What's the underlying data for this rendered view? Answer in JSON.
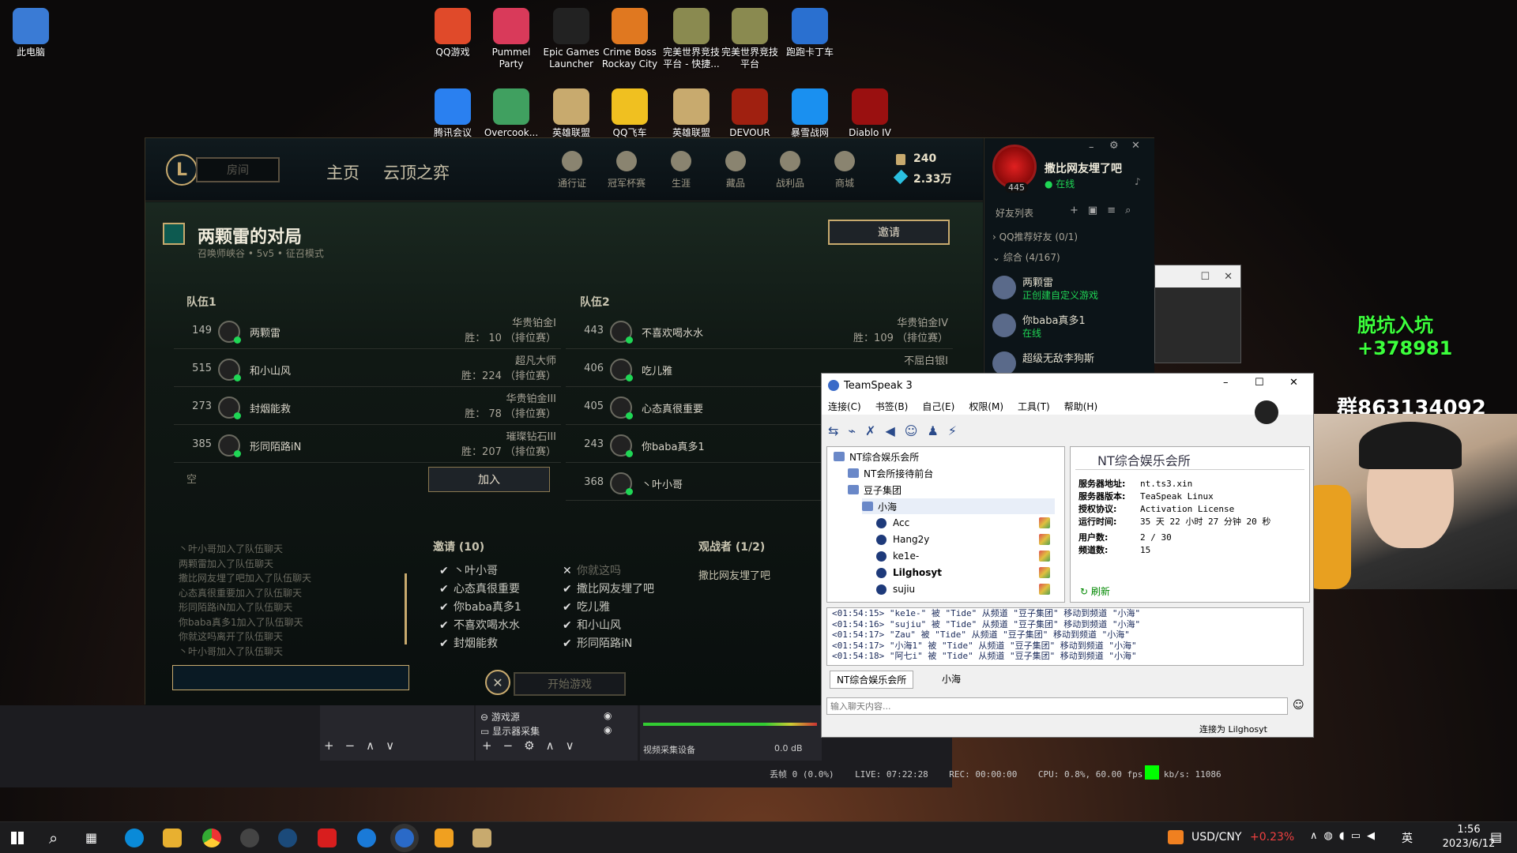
{
  "desktop": {
    "icons": [
      {
        "label": "此电脑",
        "color": "#3a7bd5"
      },
      {
        "label": "QQ游戏",
        "color": "#e04a2a"
      },
      {
        "label": "Pummel Party",
        "color": "#d93a5a"
      },
      {
        "label": "Epic Games Launcher",
        "color": "#222222"
      },
      {
        "label": "Crime Boss Rockay City",
        "color": "#e07820"
      },
      {
        "label": "完美世界竞技平台 - 快捷...",
        "color": "#8a8a50"
      },
      {
        "label": "完美世界竞技平台",
        "color": "#8a8a50"
      },
      {
        "label": "跑跑卡丁车",
        "color": "#2a70d0"
      },
      {
        "label": "腾讯会议",
        "color": "#2a80f0"
      },
      {
        "label": "Overcook...",
        "color": "#40a060"
      },
      {
        "label": "英雄联盟",
        "color": "#c8aa6e"
      },
      {
        "label": "QQ飞车",
        "color": "#f0c020"
      },
      {
        "label": "英雄联盟",
        "color": "#c8aa6e"
      },
      {
        "label": "DEVOUR",
        "color": "#a02010"
      },
      {
        "label": "暴雪战网",
        "color": "#1a90f0"
      },
      {
        "label": "Diablo IV",
        "color": "#9a1010"
      }
    ],
    "overlay_text_1": "脱坑入坑+378981",
    "overlay_text_2": "群863134092"
  },
  "lol": {
    "search_placeholder": "房间",
    "tabs": [
      "主页",
      "云顶之弈"
    ],
    "nav_icons": [
      {
        "label": "通行证",
        "icon": "pass-icon"
      },
      {
        "label": "冠军杯赛",
        "icon": "trophy-icon"
      },
      {
        "label": "生涯",
        "icon": "profile-icon"
      },
      {
        "label": "藏品",
        "icon": "collection-icon"
      },
      {
        "label": "战利品",
        "icon": "loot-icon"
      },
      {
        "label": "商城",
        "icon": "store-icon"
      }
    ],
    "currency": {
      "rp": "240",
      "be": "2.33万"
    },
    "profile": {
      "name": "撒比网友埋了吧",
      "status": "在线",
      "level": "445"
    },
    "lobby": {
      "title": "两颗雷的对局",
      "map": "召唤师峡谷",
      "mode_size": "5v5",
      "mode": "征召模式",
      "invite_button": "邀请",
      "team1_label": "队伍1",
      "team2_label": "队伍2",
      "team1": [
        {
          "level": "149",
          "name": "两颗雷",
          "rank": "华贵铂金I",
          "wins": "胜： 10  （排位赛）"
        },
        {
          "level": "515",
          "name": "和小山风",
          "rank": "超凡大师",
          "wins": "胜：224  （排位赛）"
        },
        {
          "level": "273",
          "name": "封烟能救",
          "rank": "华贵铂金III",
          "wins": "胜： 78  （排位赛）"
        },
        {
          "level": "385",
          "name": "形同陌路iN",
          "rank": "璀璨钻石III",
          "wins": "胜：207  （排位赛）"
        }
      ],
      "team2": [
        {
          "level": "443",
          "name": "不喜欢喝水水",
          "rank": "华贵铂金IV",
          "wins": "胜：109  （排位赛）"
        },
        {
          "level": "406",
          "name": "吃儿雅",
          "rank": "不屈白银I",
          "wins": ""
        },
        {
          "level": "405",
          "name": "心态真很重要",
          "rank": "",
          "wins": ""
        },
        {
          "level": "243",
          "name": "你baba真多1",
          "rank": "",
          "wins": ""
        },
        {
          "level": "368",
          "name": "丶叶小哥",
          "rank": "",
          "wins": ""
        }
      ],
      "empty_slot": "空",
      "join_button": "加入",
      "chat_log": [
        "丶叶小哥加入了队伍聊天",
        "两颗雷加入了队伍聊天",
        "撒比网友埋了吧加入了队伍聊天",
        "心态真很重要加入了队伍聊天",
        "形同陌路iN加入了队伍聊天",
        "你baba真多1加入了队伍聊天",
        "你就这吗离开了队伍聊天",
        "丶叶小哥加入了队伍聊天"
      ],
      "invites_label": "邀请 (10)",
      "invites_col1": [
        {
          "m": "✔",
          "n": "丶叶小哥"
        },
        {
          "m": "✔",
          "n": "心态真很重要"
        },
        {
          "m": "✔",
          "n": "你baba真多1"
        },
        {
          "m": "✔",
          "n": "不喜欢喝水水"
        },
        {
          "m": "✔",
          "n": "封烟能救"
        }
      ],
      "invites_col2": [
        {
          "m": "✕",
          "n": "你就这吗"
        },
        {
          "m": "✔",
          "n": "撒比网友埋了吧"
        },
        {
          "m": "✔",
          "n": "吃儿雅"
        },
        {
          "m": "✔",
          "n": "和小山风"
        },
        {
          "m": "✔",
          "n": "形同陌路iN"
        }
      ],
      "spectators_label": "观战者 (1/2)",
      "spectator": "撒比网友埋了吧",
      "start_button": "开始游戏"
    },
    "friends": {
      "header": "好友列表",
      "group1": "QQ推荐好友 (0/1)",
      "group2": "综合 (4/167)",
      "list": [
        {
          "name": "两颗雷",
          "status": "正创建自定义游戏"
        },
        {
          "name": "你baba真多1",
          "status": "在线"
        },
        {
          "name": "超级无敌李狗斯",
          "status": ""
        }
      ]
    }
  },
  "teamspeak": {
    "title": "TeamSpeak 3",
    "menu": [
      "连接(C)",
      "书签(B)",
      "自己(E)",
      "权限(M)",
      "工具(T)",
      "帮助(H)"
    ],
    "tree": [
      {
        "label": "NT综合娱乐会所",
        "type": "server",
        "indent": 0
      },
      {
        "label": "NT会所接待前台",
        "type": "channel",
        "indent": 1
      },
      {
        "label": "豆子集团",
        "type": "channel",
        "indent": 1
      },
      {
        "label": "小海",
        "type": "channel",
        "indent": 2
      },
      {
        "label": "Acc",
        "type": "user",
        "indent": 3
      },
      {
        "label": "Hang2y",
        "type": "user",
        "indent": 3
      },
      {
        "label": "ke1e-",
        "type": "user",
        "indent": 3
      },
      {
        "label": "Lilghosyt",
        "type": "user",
        "indent": 3
      },
      {
        "label": "sujiu",
        "type": "user",
        "indent": 3
      }
    ],
    "info": {
      "server_name": "NT综合娱乐会所",
      "rows": [
        {
          "k": "服务器地址:",
          "v": "nt.ts3.xin"
        },
        {
          "k": "服务器版本:",
          "v": "TeaSpeak Linux"
        },
        {
          "k": "授权协议:",
          "v": "Activation License"
        },
        {
          "k": "运行时间:",
          "v": "35 天 22 小时 27 分钟 20 秒"
        },
        {
          "k": "用户数:",
          "v": "2 / 30"
        },
        {
          "k": "频道数:",
          "v": "15"
        }
      ],
      "refresh": "刷新"
    },
    "log": [
      "<01:54:15> \"ke1e-\" 被 \"Tide\" 从频道 \"豆子集团\" 移动到频道 \"小海\"",
      "<01:54:16> \"sujiu\" 被 \"Tide\" 从频道 \"豆子集团\" 移动到频道 \"小海\"",
      "<01:54:17> \"Zau\" 被 \"Tide\" 从频道 \"豆子集团\" 移动到频道 \"小海\"",
      "<01:54:17> \"小海1\" 被 \"Tide\" 从频道 \"豆子集团\" 移动到频道 \"小海\"",
      "<01:54:18> \"阿七i\" 被 \"Tide\" 从频道 \"豆子集团\" 移动到频道 \"小海\""
    ],
    "tabs": [
      "NT综合娱乐会所",
      "小海"
    ],
    "chat_placeholder": "输入聊天内容...",
    "status": "连接为 Lilghosyt"
  },
  "obs": {
    "sources": [
      "游戏源",
      "显示器采集"
    ],
    "mixer_label": "视频采集设备",
    "mixer_db": "0.0 dB",
    "status": "丢帧 0 (0.0%)    LIVE: 07:22:28    REC: 00:00:00    CPU: 0.8%, 60.00 fps    kb/s: 11086"
  },
  "taskbar": {
    "ticker": "USD/CNY",
    "ticker_change": "+0.23%",
    "lang": "英",
    "time": "1:56",
    "date": "2023/6/12"
  }
}
